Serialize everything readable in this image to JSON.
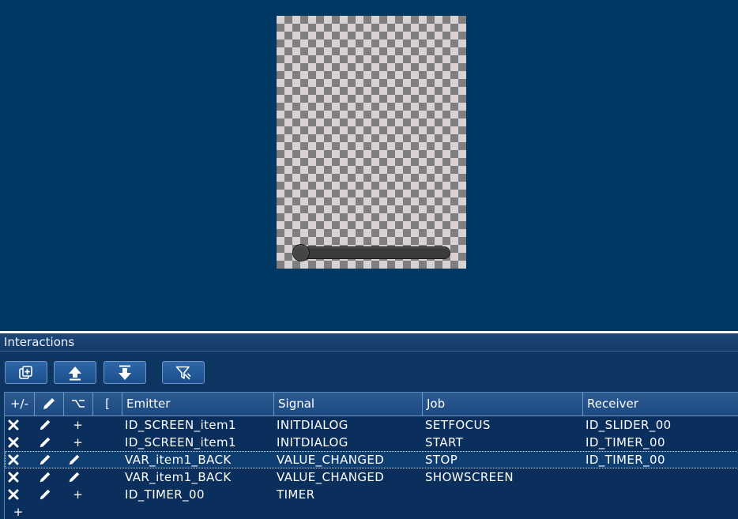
{
  "panel": {
    "title": "Interactions"
  },
  "toolbar": {
    "buttons": [
      {
        "name": "duplicate-icon"
      },
      {
        "name": "move-up-icon"
      },
      {
        "name": "move-down-icon"
      },
      {
        "name": "filter-icon"
      }
    ]
  },
  "table": {
    "headers": {
      "toggle": "+/-",
      "edit": "pencil-icon",
      "branch": "branch-icon",
      "bracket": "[",
      "emitter": "Emitter",
      "signal": "Signal",
      "job": "Job",
      "receiver": "Receiver"
    },
    "rows": [
      {
        "emitter": "ID_SCREEN_item1",
        "signal": "INITDIALOG",
        "job": "SETFOCUS",
        "receiver": "ID_SLIDER_00",
        "third": "+"
      },
      {
        "emitter": "ID_SCREEN_item1",
        "signal": "INITDIALOG",
        "job": "START",
        "receiver": "ID_TIMER_00",
        "third": "+"
      },
      {
        "emitter": "VAR_item1_BACK",
        "signal": "VALUE_CHANGED",
        "job": "STOP",
        "receiver": "ID_TIMER_00",
        "third": "pencil-icon"
      },
      {
        "emitter": "VAR_item1_BACK",
        "signal": "VALUE_CHANGED",
        "job": "SHOWSCREEN",
        "receiver": "",
        "third": "pencil-icon"
      },
      {
        "emitter": "ID_TIMER_00",
        "signal": "TIMER",
        "job": "",
        "receiver": "",
        "third": "+"
      }
    ],
    "add_row": "+"
  },
  "colors": {
    "background": "#003763",
    "panel": "#0c3562",
    "header": "#1c4a81"
  }
}
